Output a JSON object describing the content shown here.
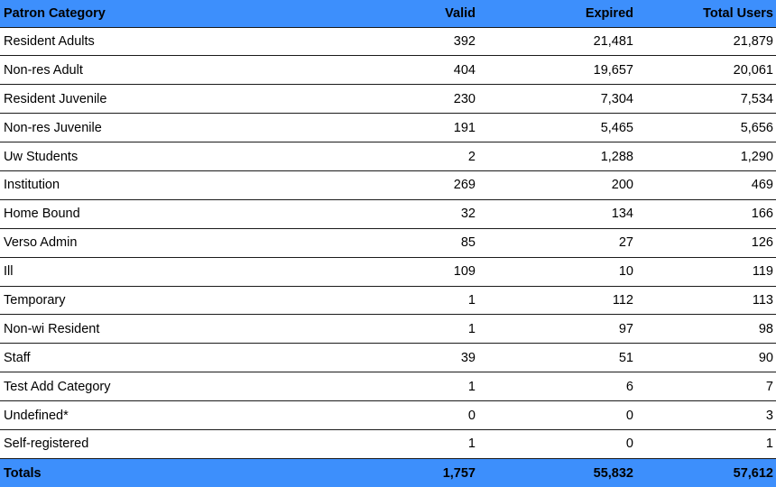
{
  "table": {
    "columns": [
      {
        "key": "category",
        "label": "Patron Category",
        "align": "left"
      },
      {
        "key": "valid",
        "label": "Valid",
        "align": "right"
      },
      {
        "key": "expired",
        "label": "Expired",
        "align": "right"
      },
      {
        "key": "total",
        "label": "Total Users",
        "align": "right"
      }
    ],
    "header_background": "#3d8ffc",
    "totals_background": "#3d8ffc",
    "rows": [
      {
        "category": "Resident Adults",
        "valid": "392",
        "expired": "21,481",
        "total": "21,879"
      },
      {
        "category": "Non-res Adult",
        "valid": "404",
        "expired": "19,657",
        "total": "20,061"
      },
      {
        "category": "Resident Juvenile",
        "valid": "230",
        "expired": "7,304",
        "total": "7,534"
      },
      {
        "category": "Non-res Juvenile",
        "valid": "191",
        "expired": "5,465",
        "total": "5,656"
      },
      {
        "category": "Uw Students",
        "valid": "2",
        "expired": "1,288",
        "total": "1,290"
      },
      {
        "category": "Institution",
        "valid": "269",
        "expired": "200",
        "total": "469"
      },
      {
        "category": "Home Bound",
        "valid": "32",
        "expired": "134",
        "total": "166"
      },
      {
        "category": "Verso Admin",
        "valid": "85",
        "expired": "27",
        "total": "126"
      },
      {
        "category": "Ill",
        "valid": "109",
        "expired": "10",
        "total": "119"
      },
      {
        "category": "Temporary",
        "valid": "1",
        "expired": "112",
        "total": "113"
      },
      {
        "category": "Non-wi Resident",
        "valid": "1",
        "expired": "97",
        "total": "98"
      },
      {
        "category": "Staff",
        "valid": "39",
        "expired": "51",
        "total": "90"
      },
      {
        "category": "Test Add Category",
        "valid": "1",
        "expired": "6",
        "total": "7"
      },
      {
        "category": "Undefined*",
        "valid": "0",
        "expired": "0",
        "total": "3"
      },
      {
        "category": "Self-registered",
        "valid": "1",
        "expired": "0",
        "total": "1"
      }
    ],
    "totals": {
      "category": "Totals",
      "valid": "1,757",
      "expired": "55,832",
      "total": "57,612"
    }
  }
}
